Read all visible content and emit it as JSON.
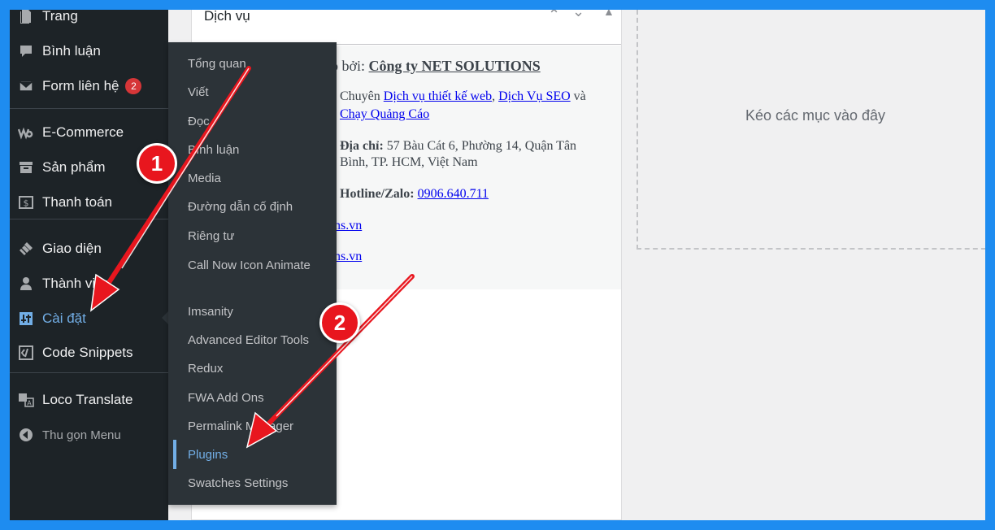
{
  "sidebar": {
    "items": [
      {
        "label": "Trang",
        "icon": "page-icon"
      },
      {
        "label": "Bình luận",
        "icon": "comment-icon"
      },
      {
        "label": "Form liên hệ",
        "icon": "mail-icon",
        "badge": "2"
      },
      {
        "label": "E-Commerce",
        "icon": "woo-icon"
      },
      {
        "label": "Sản phẩm",
        "icon": "archive-icon"
      },
      {
        "label": "Thanh toán",
        "icon": "payment-icon"
      },
      {
        "label": "Giao diện",
        "icon": "brush-icon"
      },
      {
        "label": "Thành viên",
        "icon": "user-icon"
      },
      {
        "label": "Cài đặt",
        "icon": "settings-icon",
        "active": true
      },
      {
        "label": "Code Snippets",
        "icon": "code-icon"
      },
      {
        "label": "Loco Translate",
        "icon": "translate-icon"
      },
      {
        "label": "Thu gọn Menu",
        "icon": "collapse-icon"
      }
    ]
  },
  "flyout": {
    "items": [
      "Tổng quan",
      "Viết",
      "Đọc",
      "Bình luận",
      "Media",
      "Đường dẫn cố định",
      "Riêng tư",
      "Call Now Icon Animate",
      "Imsanity",
      "Advanced Editor Tools",
      "Redux",
      "FWA Add Ons",
      "Permalink Manager",
      "Plugins",
      "Swatches Settings"
    ],
    "current": "Plugins"
  },
  "widget": {
    "title": "Dịch vụ",
    "provider_prefix": "ấp bởi:",
    "provider_name": "Công ty NET SOLUTIONS",
    "service_prefix": "Chuyên",
    "service_link_1": "Dịch vụ thiết kế web",
    "service_sep": ",",
    "service_link_2": "Dịch Vụ SEO",
    "service_and": "và",
    "service_link_3": "Chạy Quảng Cáo",
    "address_label": "Địa chỉ:",
    "address_line_1": "57 Bàu Cát 6, Phường 14, Quận Tân",
    "address_line_2": "Bình, TP. HCM, Việt Nam",
    "hotline_label": "Hotline/Zalo:",
    "hotline_value": "0906.640.711",
    "link_tail_1": "ons.vn",
    "link_tail_2": "ons.vn"
  },
  "dropzone": {
    "text": "Kéo các mục vào đây"
  },
  "annotations": {
    "step_1": "1",
    "step_2": "2",
    "arrow_color": "#e8161e"
  }
}
